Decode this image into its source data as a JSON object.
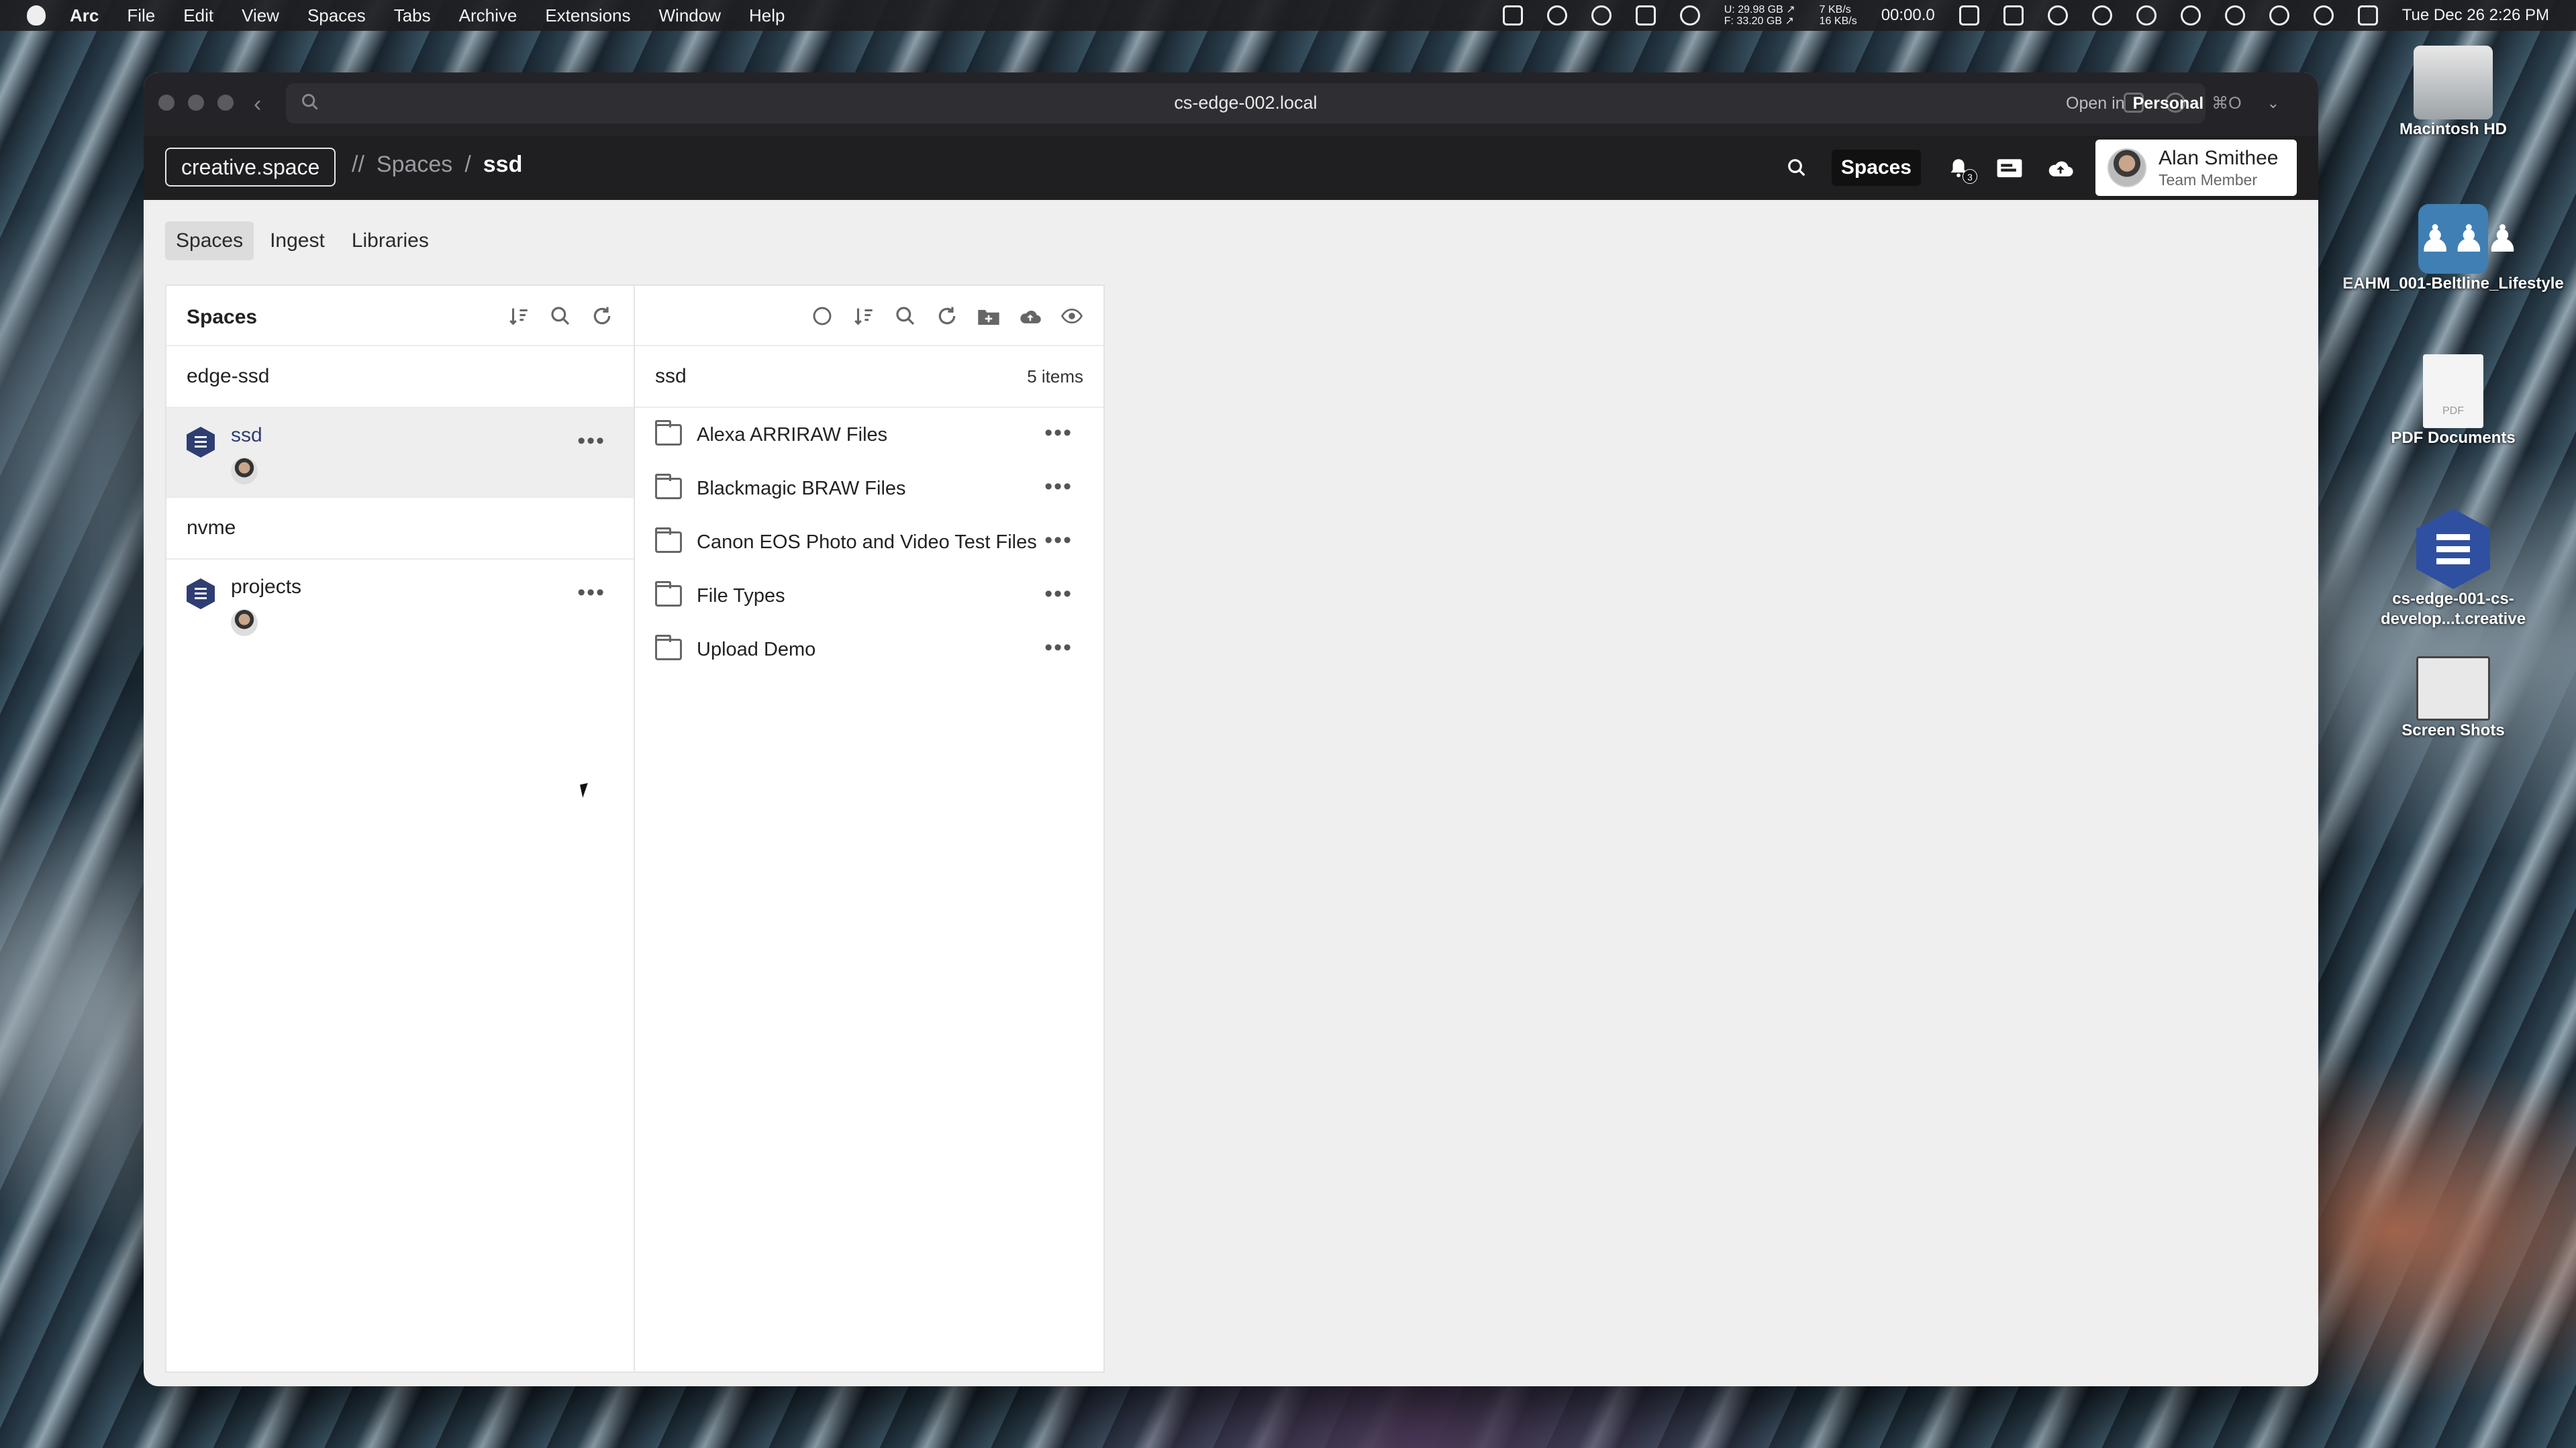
{
  "menubar": {
    "app": "Arc",
    "items": [
      "File",
      "Edit",
      "View",
      "Spaces",
      "Tabs",
      "Archive",
      "Extensions",
      "Window",
      "Help"
    ],
    "stats": {
      "disk_used": "U: 29.98 GB ↗",
      "disk_free": "F: 33.20 GB ↗",
      "net_up": "7 KB/s",
      "net_down": "16 KB/s"
    },
    "timer": "00:00.0",
    "clock": "Tue Dec 26  2:26 PM"
  },
  "browser": {
    "url": "cs-edge-002.local",
    "open_in_prefix": "Open in",
    "open_in_profile": "Personal",
    "open_in_shortcut": "⌘O"
  },
  "appbar": {
    "brand": "creative.space",
    "crumb_sep": "//",
    "crumb_1": "Spaces",
    "crumb_div": "/",
    "crumb_current": "ssd",
    "spaces_button": "Spaces",
    "notification_count": "3",
    "user_name": "Alan Smithee",
    "user_role": "Team Member"
  },
  "tabs": [
    "Spaces",
    "Ingest",
    "Libraries"
  ],
  "left_panel": {
    "title": "Spaces",
    "groups": [
      {
        "label": "edge-ssd",
        "spaces": [
          {
            "name": "ssd"
          }
        ]
      },
      {
        "label": "nvme",
        "spaces": [
          {
            "name": "projects"
          }
        ]
      }
    ]
  },
  "right_panel": {
    "folder": "ssd",
    "count": "5 items",
    "items": [
      "Alexa ARRIRAW Files",
      "Blackmagic BRAW Files",
      "Canon EOS Photo and Video Test Files",
      "File Types",
      "Upload Demo"
    ]
  },
  "desktop": {
    "items": [
      "Macintosh HD",
      "EAHM_001-Beltline_Lifestyle",
      "PDF Documents",
      "cs-edge-001-cs-develop...t.creative",
      "Screen Shots"
    ]
  },
  "colors": {
    "accent": "#2f3e72",
    "appbar": "#1f1f22",
    "selected_row": "#eeeeee"
  }
}
